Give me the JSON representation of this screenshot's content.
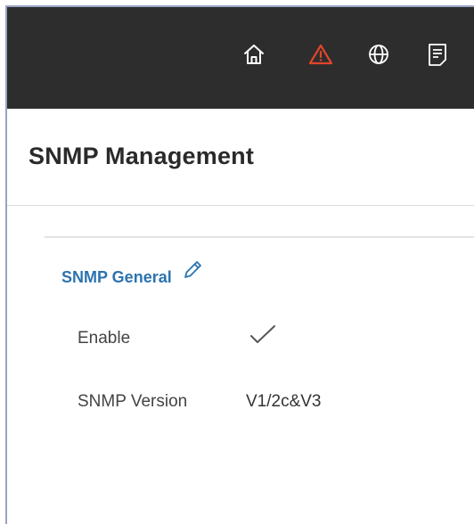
{
  "header": {
    "icons": [
      "home-icon",
      "alert-icon",
      "globe-icon",
      "document-icon"
    ]
  },
  "page": {
    "title": "SNMP Management"
  },
  "section": {
    "title": "SNMP General",
    "fields": [
      {
        "label": "Enable",
        "value": "enabled",
        "icon": "checkmark-icon"
      },
      {
        "label": "SNMP Version",
        "value": "V1/2c&V3"
      }
    ]
  },
  "colors": {
    "topbar": "#2d2d2d",
    "icon": "#ffffff",
    "alert": "#e1452b",
    "link": "#2c73b0"
  }
}
